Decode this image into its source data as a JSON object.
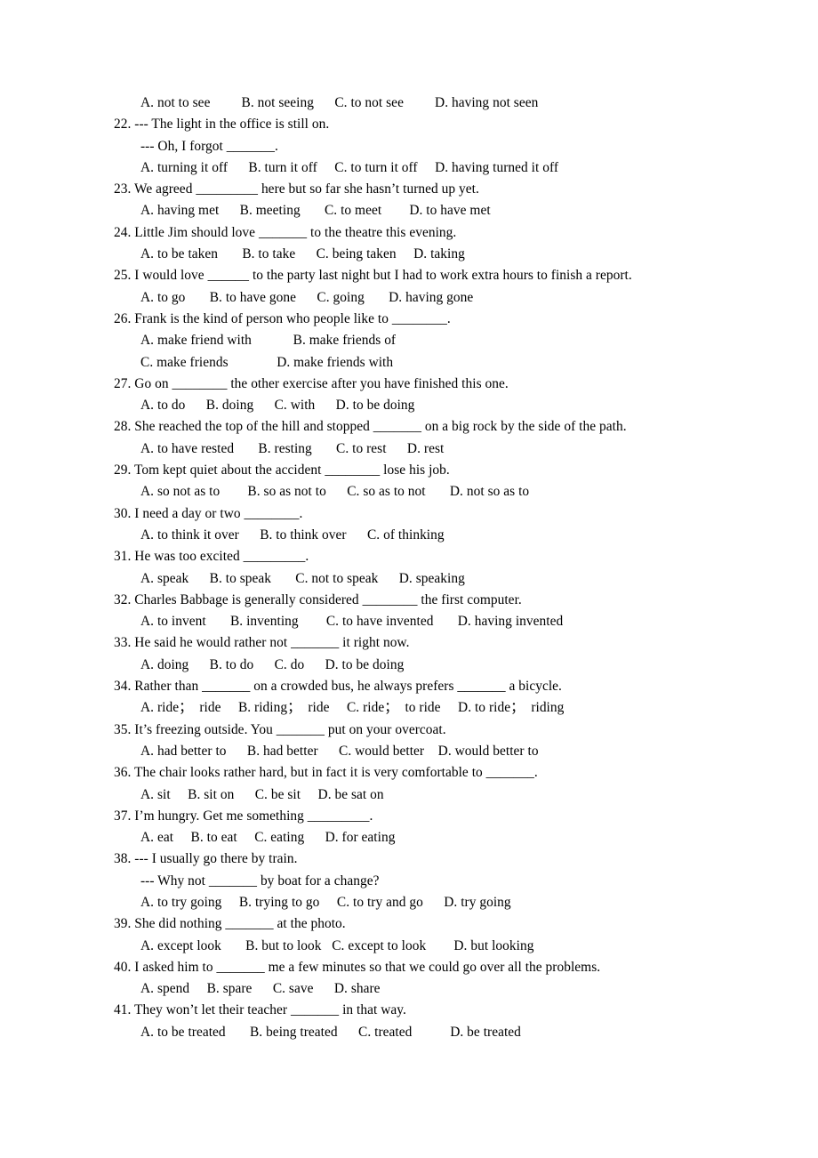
{
  "document": {
    "type": "multiple-choice-grammar-exercise",
    "page_background": "#ffffff",
    "text_color": "#000000",
    "lines": [
      {
        "id": "l01",
        "kind": "options",
        "text": "A. not to see         B. not seeing      C. to not see         D. having not seen"
      },
      {
        "id": "l02",
        "kind": "stem",
        "text": "22. --- The light in the office is still on."
      },
      {
        "id": "l03",
        "kind": "continuation",
        "text": "--- Oh, I forgot _______."
      },
      {
        "id": "l04",
        "kind": "options",
        "text": "A. turning it off      B. turn it off     C. to turn it off     D. having turned it off"
      },
      {
        "id": "l05",
        "kind": "stem",
        "text": "23. We agreed _________ here but so far she hasn’t turned up yet."
      },
      {
        "id": "l06",
        "kind": "options",
        "text": "A. having met      B. meeting       C. to meet        D. to have met"
      },
      {
        "id": "l07",
        "kind": "stem",
        "text": "24. Little Jim should love _______ to the theatre this evening."
      },
      {
        "id": "l08",
        "kind": "options",
        "text": "A. to be taken       B. to take      C. being taken     D. taking"
      },
      {
        "id": "l09",
        "kind": "stem",
        "text": "25. I would love ______ to the party last night but I had to work extra hours to finish a report."
      },
      {
        "id": "l10",
        "kind": "options",
        "text": "A. to go       B. to have gone      C. going       D. having gone"
      },
      {
        "id": "l11",
        "kind": "stem",
        "text": "26. Frank is the kind of person who people like to ________."
      },
      {
        "id": "l12",
        "kind": "options",
        "text": "A. make friend with            B. make friends of"
      },
      {
        "id": "l13",
        "kind": "options",
        "text": "C. make friends              D. make friends with"
      },
      {
        "id": "l14",
        "kind": "stem",
        "text": "27. Go on ________ the other exercise after you have finished this one."
      },
      {
        "id": "l15",
        "kind": "options",
        "text": "A. to do      B. doing      C. with      D. to be doing"
      },
      {
        "id": "l16",
        "kind": "stem",
        "text": "28. She reached the top of the hill and stopped _______ on a big rock by the side of the path."
      },
      {
        "id": "l17",
        "kind": "options",
        "text": "A. to have rested       B. resting       C. to rest      D. rest"
      },
      {
        "id": "l18",
        "kind": "stem",
        "text": "29. Tom kept quiet about the accident ________ lose his job."
      },
      {
        "id": "l19",
        "kind": "options",
        "text": "A. so not as to        B. so as not to      C. so as to not       D. not so as to"
      },
      {
        "id": "l20",
        "kind": "stem",
        "text": "30. I need a day or two ________."
      },
      {
        "id": "l21",
        "kind": "options",
        "text": "A. to think it over      B. to think over      C. of thinking"
      },
      {
        "id": "l22",
        "kind": "stem",
        "text": "31. He was too excited _________."
      },
      {
        "id": "l23",
        "kind": "options",
        "text": "A. speak      B. to speak       C. not to speak      D. speaking"
      },
      {
        "id": "l24",
        "kind": "stem",
        "text": "32. Charles Babbage is generally considered ________ the first computer."
      },
      {
        "id": "l25",
        "kind": "options",
        "text": "A. to invent       B. inventing        C. to have invented       D. having invented"
      },
      {
        "id": "l26",
        "kind": "stem",
        "text": "33. He said he would rather not _______ it right now."
      },
      {
        "id": "l27",
        "kind": "options",
        "text": "A. doing      B. to do      C. do      D. to be doing"
      },
      {
        "id": "l28",
        "kind": "stem",
        "text": "34. Rather than _______ on a crowded bus, he always prefers _______ a bicycle."
      },
      {
        "id": "l29",
        "kind": "options",
        "text": "A. ride；  ride     B. riding；  ride     C. ride；  to ride     D. to ride；  riding"
      },
      {
        "id": "l30",
        "kind": "stem",
        "text": "35. It’s freezing outside. You _______ put on your overcoat."
      },
      {
        "id": "l31",
        "kind": "options",
        "text": "A. had better to      B. had better      C. would better    D. would better to"
      },
      {
        "id": "l32",
        "kind": "stem",
        "text": "36. The chair looks rather hard, but in fact it is very comfortable to _______."
      },
      {
        "id": "l33",
        "kind": "options",
        "text": "A. sit     B. sit on      C. be sit     D. be sat on"
      },
      {
        "id": "l34",
        "kind": "stem",
        "text": "37. I’m hungry. Get me something _________."
      },
      {
        "id": "l35",
        "kind": "options",
        "text": "A. eat     B. to eat     C. eating      D. for eating"
      },
      {
        "id": "l36",
        "kind": "stem",
        "text": "38. --- I usually go there by train."
      },
      {
        "id": "l37",
        "kind": "continuation",
        "text": "--- Why not _______ by boat for a change?"
      },
      {
        "id": "l38",
        "kind": "options",
        "text": "A. to try going     B. trying to go     C. to try and go      D. try going"
      },
      {
        "id": "l39",
        "kind": "stem",
        "text": "39. She did nothing _______ at the photo."
      },
      {
        "id": "l40",
        "kind": "options",
        "text": "A. except look       B. but to look   C. except to look        D. but looking"
      },
      {
        "id": "l41",
        "kind": "stem",
        "text": "40. I asked him to _______ me a few minutes so that we could go over all the problems."
      },
      {
        "id": "l42",
        "kind": "options",
        "text": "A. spend     B. spare      C. save      D. share"
      },
      {
        "id": "l43",
        "kind": "stem",
        "text": "41. They won’t let their teacher _______ in that way."
      },
      {
        "id": "l44",
        "kind": "options",
        "text": "A. to be treated       B. being treated      C. treated           D. be treated"
      }
    ]
  }
}
